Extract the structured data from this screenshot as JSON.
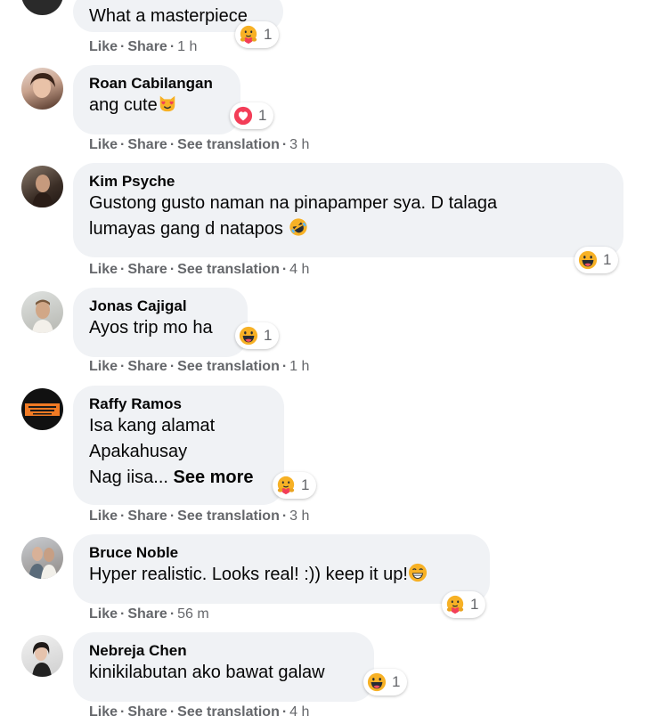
{
  "actions": {
    "like": "Like",
    "share": "Share",
    "translate": "See translation",
    "sep": "·"
  },
  "comments": [
    {
      "name": "",
      "text": "What a masterpiece",
      "time": "1 h",
      "reaction": "care",
      "count": "1",
      "has_translation": false
    },
    {
      "name": "Roan Cabilangan",
      "text": "ang cute",
      "inline_emoji": "heart-eyes-cat-emoji",
      "time": "3 h",
      "reaction": "love",
      "count": "1",
      "has_translation": true
    },
    {
      "name": "Kim Psyche",
      "text_lines": [
        "Gustong gusto naman na pinapamper sya. D talaga",
        "lumayas gang d natapos"
      ],
      "inline_emoji": "rofl-emoji",
      "time": "4 h",
      "reaction": "haha",
      "count": "1",
      "has_translation": true
    },
    {
      "name": "Jonas Cajigal",
      "text": "Ayos trip mo ha",
      "time": "1 h",
      "reaction": "haha",
      "count": "1",
      "has_translation": true
    },
    {
      "name": "Raffy Ramos",
      "text_lines": [
        "Isa kang alamat",
        "Apakahusay",
        "Nag iisa..."
      ],
      "see_more": "See more",
      "time": "3 h",
      "reaction": "care",
      "count": "1",
      "has_translation": true
    },
    {
      "name": "Bruce Noble",
      "text": "Hyper realistic. Looks real! :)) keep it up!",
      "inline_emoji": "grinning-emoji",
      "time": "56 m",
      "reaction": "care",
      "count": "1",
      "has_translation": false
    },
    {
      "name": "Nebreja Chen",
      "text": "kinikilabutan ako bawat galaw",
      "time": "4 h",
      "reaction": "haha",
      "count": "1",
      "has_translation": true
    }
  ],
  "colors": {
    "bubble": "#f0f2f5",
    "meta": "#65676b",
    "haha": "#f7b125",
    "love": "#f33e58",
    "text": "#050505"
  }
}
